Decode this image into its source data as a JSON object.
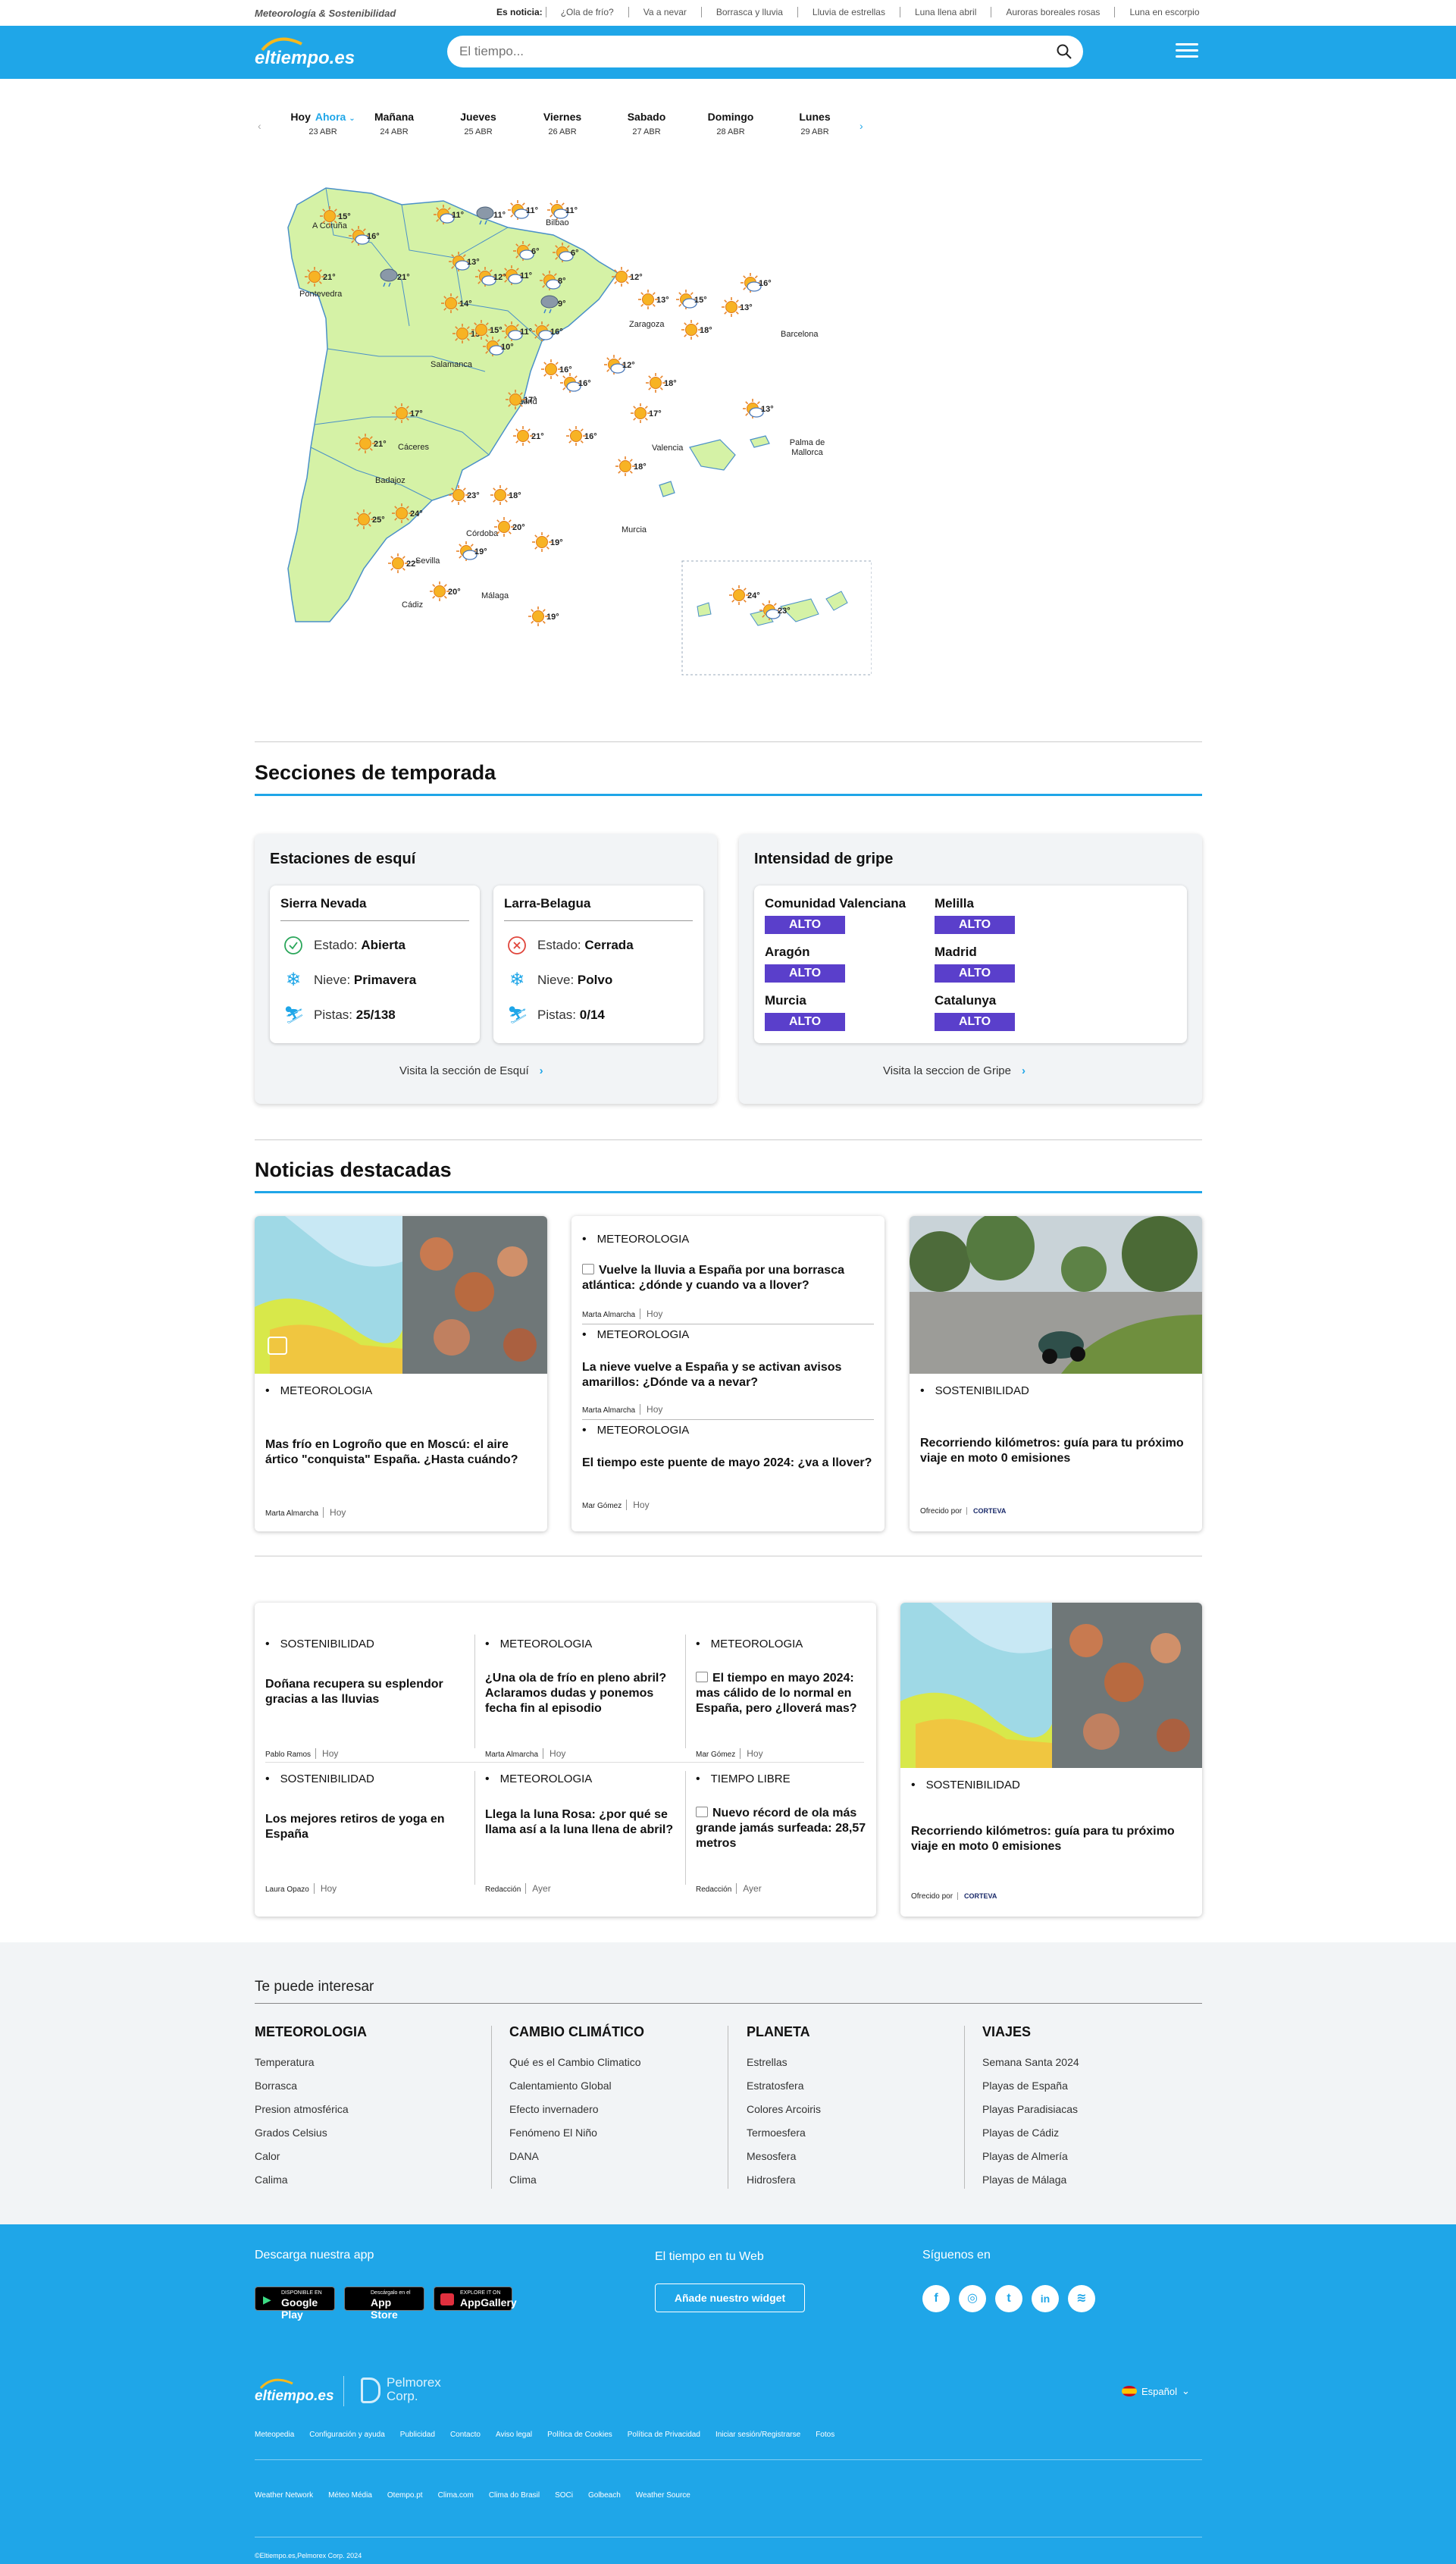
{
  "topbar": {
    "brand": "Meteorología & Sostenibilidad",
    "news_label": "Es noticia:",
    "news": [
      "¿Ola de frío?",
      "Va a nevar",
      "Borrasca y lluvia",
      "Lluvia de estrellas",
      "Luna llena abril",
      "Auroras boreales rosas",
      "Luna en escorpio"
    ]
  },
  "header": {
    "logo": "eltiempo.es",
    "search_placeholder": "El tiempo..."
  },
  "days": [
    {
      "name": "Hoy",
      "now": "Ahora",
      "date": "23 ABR"
    },
    {
      "name": "Mañana",
      "date": "24 ABR"
    },
    {
      "name": "Jueves",
      "date": "25 ABR"
    },
    {
      "name": "Viernes",
      "date": "26 ABR"
    },
    {
      "name": "Sabado",
      "date": "27 ABR"
    },
    {
      "name": "Domingo",
      "date": "28 ABR"
    },
    {
      "name": "Lunes",
      "date": "29 ABR"
    }
  ],
  "map": {
    "cities": [
      "A Coruña",
      "Bilbao",
      "Pontevedra",
      "Zaragoza",
      "Barcelona",
      "Salamanca",
      "Madrid",
      "Valencia",
      "Palma de Mallorca",
      "Cáceres",
      "Badajoz",
      "Córdoba",
      "Murcia",
      "Sevilla",
      "Málaga",
      "Cádiz"
    ],
    "temps": [
      "15°",
      "16°",
      "21°",
      "21°",
      "11°",
      "11°",
      "11°",
      "11°",
      "6°",
      "6°",
      "13°",
      "12°",
      "11°",
      "8°",
      "9°",
      "12°",
      "13°",
      "15°",
      "13°",
      "16°",
      "14°",
      "15°",
      "15°",
      "11°",
      "10°",
      "16°",
      "18°",
      "16°",
      "12°",
      "16°",
      "18°",
      "17°",
      "17°",
      "13°",
      "17°",
      "21°",
      "16°",
      "18°",
      "21°",
      "23°",
      "18°",
      "25°",
      "24°",
      "20°",
      "19°",
      "19°",
      "22°",
      "20°",
      "19°",
      "24°",
      "23°"
    ]
  },
  "season": {
    "title": "Secciones de temporada",
    "ski": {
      "title": "Estaciones de esquí",
      "stations": [
        {
          "name": "Sierra Nevada",
          "estado_lbl": "Estado:",
          "estado": "Abierta",
          "nieve_lbl": "Nieve:",
          "nieve": "Primavera",
          "pistas_lbl": "Pistas:",
          "pistas": "25/138"
        },
        {
          "name": "Larra-Belagua",
          "estado_lbl": "Estado:",
          "estado": "Cerrada",
          "nieve_lbl": "Nieve:",
          "nieve": "Polvo",
          "pistas_lbl": "Pistas:",
          "pistas": "0/14"
        }
      ],
      "link": "Visita la sección de Esquí"
    },
    "flu": {
      "title": "Intensidad de gripe",
      "regions": [
        {
          "name": "Comunidad Valenciana",
          "level": "ALTO"
        },
        {
          "name": "Melilla",
          "level": "ALTO"
        },
        {
          "name": "Aragón",
          "level": "ALTO"
        },
        {
          "name": "Madrid",
          "level": "ALTO"
        },
        {
          "name": "Murcia",
          "level": "ALTO"
        },
        {
          "name": "Catalunya",
          "level": "ALTO"
        }
      ],
      "link": "Visita la seccion de Gripe"
    }
  },
  "news": {
    "title": "Noticias destacadas",
    "featured": [
      {
        "cat": "METEOROLOGIA",
        "title": "Mas frío en Logroño que en Moscú: el aire ártico \"conquista\" España. ¿Hasta cuándo?",
        "author": "Marta Almarcha",
        "when": "Hoy"
      },
      {
        "cat": "METEOROLOGIA",
        "title": "Vuelve la lluvia a España por una borrasca atlántica: ¿dónde y cuando va a llover?",
        "author": "Marta Almarcha",
        "when": "Hoy"
      },
      {
        "cat": "METEOROLOGIA",
        "title": "La nieve vuelve a España y se activan avisos amarillos: ¿Dónde va a nevar?",
        "author": "Marta Almarcha",
        "when": "Hoy"
      },
      {
        "cat": "METEOROLOGIA",
        "title": "El tiempo este puente de mayo 2024: ¿va a llover?",
        "author": "Mar Gómez",
        "when": "Hoy"
      },
      {
        "cat": "SOSTENIBILIDAD",
        "title": "Recorriendo kilómetros: guía para tu próximo viaje en moto 0 emisiones",
        "sponsor_lbl": "Ofrecido por",
        "sponsor": "CORTEVA"
      }
    ],
    "grid": [
      {
        "cat": "SOSTENIBILIDAD",
        "title": "Doñana recupera su esplendor gracias a las lluvias",
        "author": "Pablo Ramos",
        "when": "Hoy"
      },
      {
        "cat": "METEOROLOGIA",
        "title": "¿Una ola de frío en pleno abril? Aclaramos dudas y ponemos fecha fin al episodio",
        "author": "Marta Almarcha",
        "when": "Hoy"
      },
      {
        "cat": "METEOROLOGIA",
        "title": "El tiempo en mayo 2024: mas cálido de lo normal en España, pero ¿lloverá mas?",
        "author": "Mar Gómez",
        "when": "Hoy"
      },
      {
        "cat": "SOSTENIBILIDAD",
        "title": "Los mejores retiros de yoga en España",
        "author": "Laura Opazo",
        "when": "Hoy"
      },
      {
        "cat": "METEOROLOGIA",
        "title": "Llega la luna Rosa: ¿por qué se llama así a la luna llena de abril?",
        "author": "Redacción",
        "when": "Ayer"
      },
      {
        "cat": "TIEMPO LIBRE",
        "title": "Nuevo récord de ola más grande jamás surfeada: 28,57 metros",
        "author": "Redacción",
        "when": "Ayer"
      }
    ],
    "side": {
      "cat": "SOSTENIBILIDAD",
      "title": "Recorriendo kilómetros: guía para tu próximo viaje en moto 0 emisiones",
      "sponsor_lbl": "Ofrecido por",
      "sponsor": "CORTEVA"
    }
  },
  "interest": {
    "title": "Te puede interesar",
    "cols": [
      {
        "h": "METEOROLOGIA",
        "items": [
          "Temperatura",
          "Borrasca",
          "Presion atmosférica",
          "Grados Celsius",
          "Calor",
          "Calima"
        ]
      },
      {
        "h": "CAMBIO CLIMÁTICO",
        "items": [
          "Qué es el Cambio Climatico",
          "Calentamiento Global",
          "Efecto invernadero",
          "Fenómeno El Niño",
          "DANA",
          "Clima"
        ]
      },
      {
        "h": "PLANETA",
        "items": [
          "Estrellas",
          "Estratosfera",
          "Colores Arcoiris",
          "Termoesfera",
          "Mesosfera",
          "Hidrosfera"
        ]
      },
      {
        "h": "VIAJES",
        "items": [
          "Semana Santa 2024",
          "Playas de España",
          "Playas Paradisiacas",
          "Playas de Cádiz",
          "Playas de Almería",
          "Playas de Málaga"
        ]
      }
    ]
  },
  "footer": {
    "app_title": "Descarga nuestra app",
    "stores": [
      {
        "small": "DISPONIBLE EN",
        "name": "Google Play"
      },
      {
        "small": "Descárgalo en el",
        "name": "App Store"
      },
      {
        "small": "EXPLORE IT ON",
        "name": "AppGallery"
      }
    ],
    "widget_title": "El tiempo en tu Web",
    "widget_btn": "Añade nuestro widget",
    "social_title": "Síguenos en",
    "social": [
      "f",
      "◎",
      "t",
      "in",
      "≋"
    ],
    "logo": "eltiempo.es",
    "corp": "Pelmorex Corp.",
    "lang": "Español",
    "links1": [
      "Meteopedia",
      "Configuración y ayuda",
      "Publicidad",
      "Contacto",
      "Aviso legal",
      "Política de Cookies",
      "Política de Privacidad",
      "Iniciar sesión/Registrarse",
      "Fotos"
    ],
    "links2": [
      "Weather Network",
      "Méteo Média",
      "Otempo.pt",
      "Clima.com",
      "Clima do Brasil",
      "SOCi",
      "Golbeach",
      "Weather Source"
    ],
    "copyright": "©Eltiempo.es,Pelmorex Corp. 2024"
  }
}
